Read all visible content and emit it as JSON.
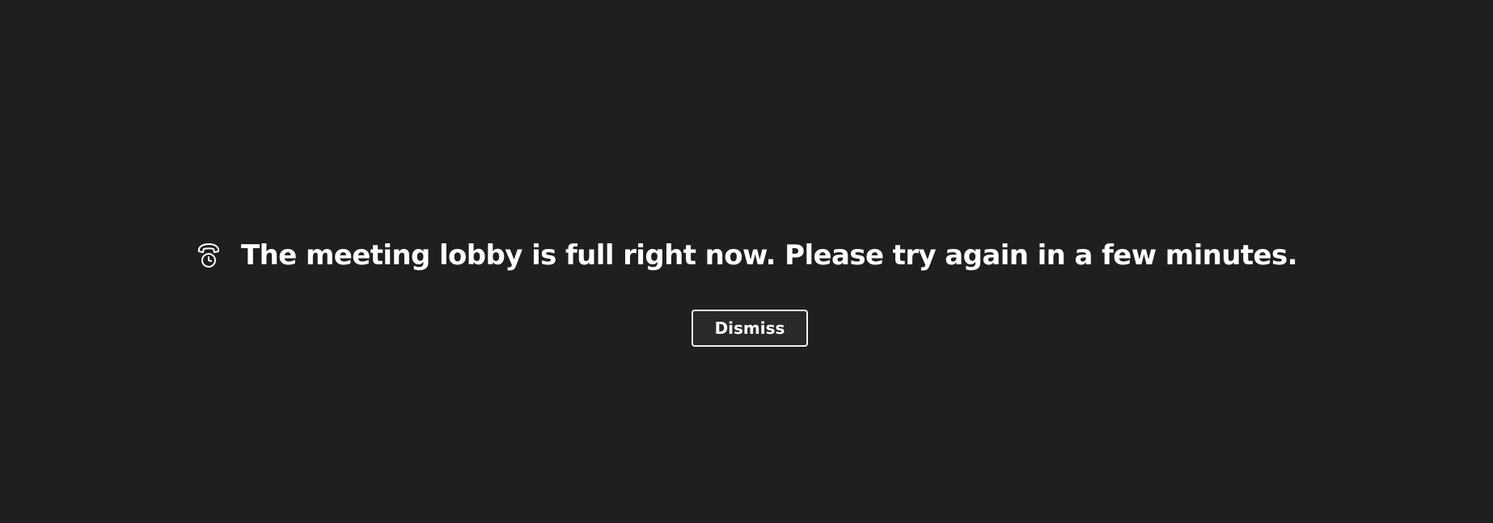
{
  "notice": {
    "icon": "phone-clock-icon",
    "message": "The meeting lobby is full right now. Please try again in a few minutes.",
    "dismiss_label": "Dismiss"
  },
  "colors": {
    "background": "#1f1f1f",
    "text": "#ffffff",
    "button_border": "#f2f2f2",
    "button_background": "#292929"
  }
}
